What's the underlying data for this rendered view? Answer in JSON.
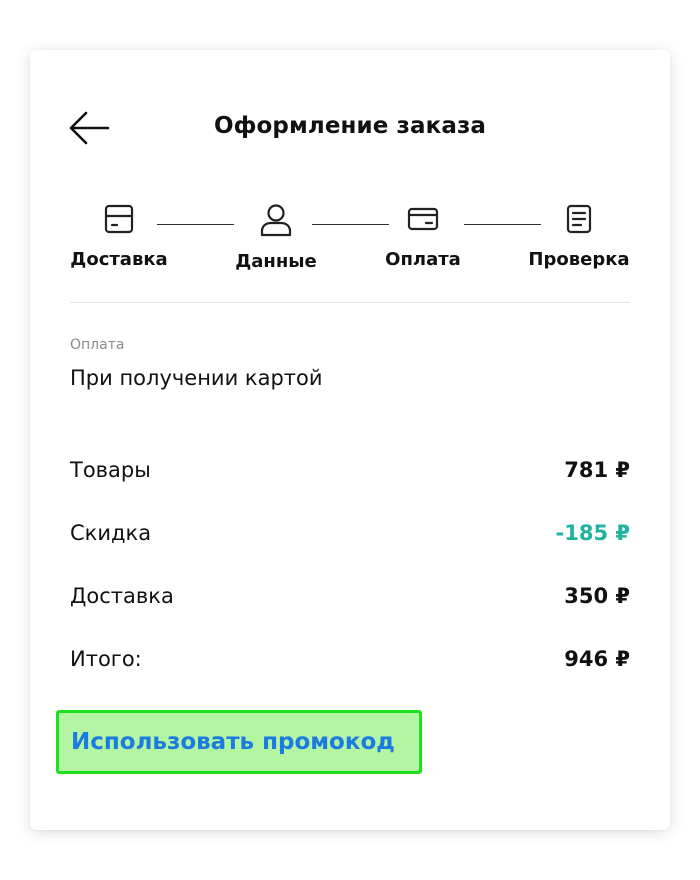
{
  "header": {
    "title": "Оформление заказа",
    "back_icon": "arrow-left-icon"
  },
  "stepper": {
    "steps": [
      {
        "label": "Доставка",
        "icon": "package-icon"
      },
      {
        "label": "Данные",
        "icon": "user-icon"
      },
      {
        "label": "Оплата",
        "icon": "credit-card-icon"
      },
      {
        "label": "Проверка",
        "icon": "document-icon"
      }
    ]
  },
  "payment": {
    "label": "Оплата",
    "value": "При получении картой"
  },
  "summary": {
    "rows": [
      {
        "label": "Товары",
        "value": "781 ₽"
      },
      {
        "label": "Скидка",
        "value": "-185 ₽"
      },
      {
        "label": "Доставка",
        "value": "350 ₽"
      },
      {
        "label": "Итого:",
        "value": "946 ₽"
      }
    ]
  },
  "promo": {
    "label": "Использовать промокод"
  },
  "colors": {
    "discount": "#1fb3a0",
    "promo_text": "#1b7be0",
    "promo_highlight_bg": "#b3f5a3",
    "promo_highlight_border": "#1fe01f"
  }
}
